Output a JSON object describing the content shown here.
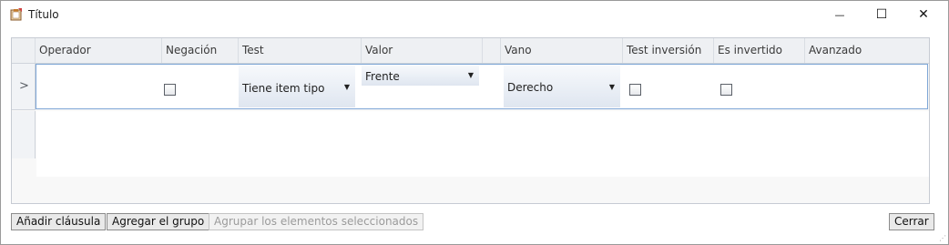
{
  "window": {
    "title": "Título",
    "minimize_glyph": "—",
    "maximize_glyph": "☐",
    "close_glyph": "✕",
    "icon": "app-clipboard-icon"
  },
  "grid": {
    "columns": [
      "Operador",
      "Negación",
      "Test",
      "Valor",
      "",
      "Vano",
      "Test inversión",
      "Es invertido",
      "Avanzado"
    ],
    "current_row_glyph": ">",
    "row": {
      "operador": "",
      "negacion_checked": false,
      "test": "Tiene item tipo",
      "valor": "Frente",
      "vano": "Derecho",
      "test_inversion_checked": false,
      "es_invertido_checked": false,
      "avanzado": ""
    },
    "combo_arrow_glyph": "▼"
  },
  "buttons": {
    "add_clause": "Añadir cláusula",
    "add_group": "Agregar el grupo",
    "group_selected": "Agrupar los elementos seleccionados",
    "close": "Cerrar"
  },
  "resize_grip_glyph": "⋰",
  "colors": {
    "selection_border": "#7ea6d6",
    "header_bg": "#eef0f3"
  }
}
